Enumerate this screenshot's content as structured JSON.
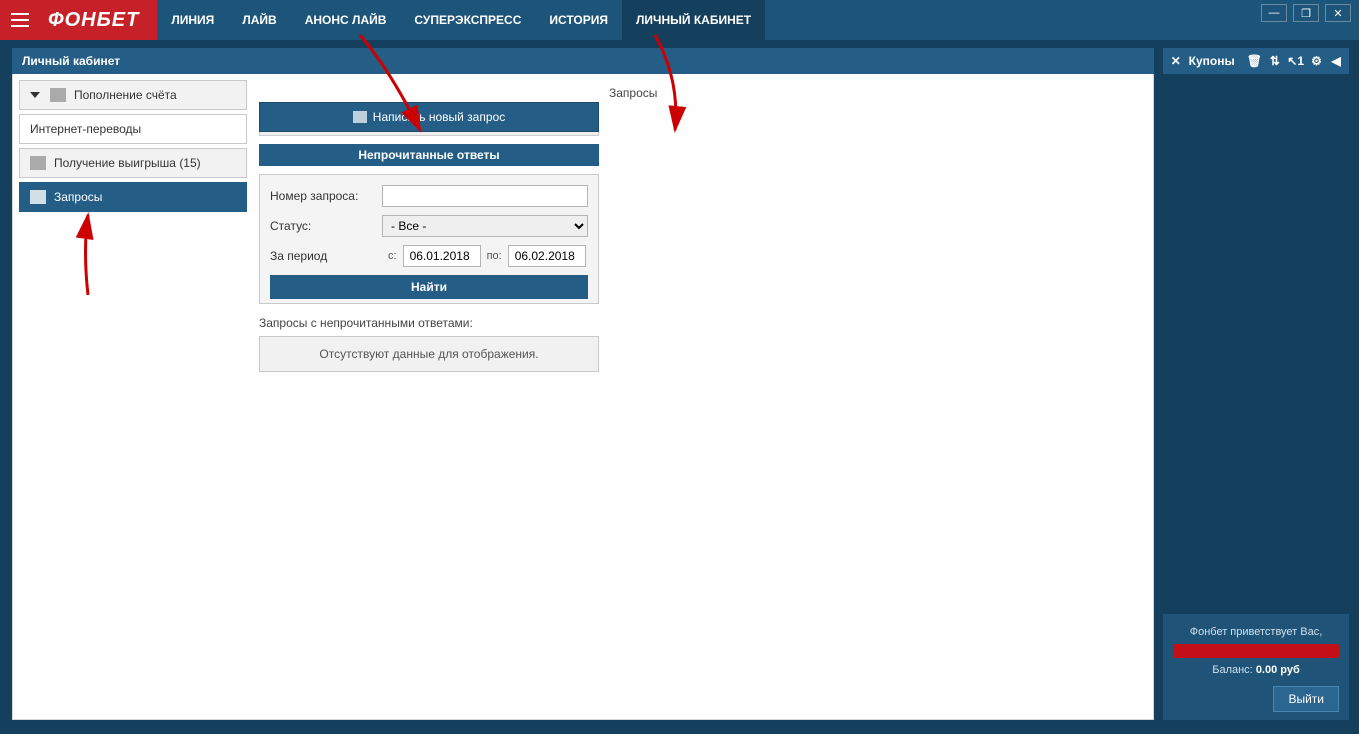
{
  "brand": "ФОНБЕТ",
  "nav": [
    "ЛИНИЯ",
    "ЛАЙВ",
    "АНОНС ЛАЙВ",
    "СУПЕРЭКСПРЕСС",
    "ИСТОРИЯ",
    "ЛИЧНЫЙ КАБИНЕТ"
  ],
  "nav_active_index": 5,
  "section_title": "Личный кабинет",
  "sidebar": {
    "items": [
      {
        "label": "Пополнение счёта",
        "kind": "group"
      },
      {
        "label": "Интернет-переводы",
        "kind": "sub"
      },
      {
        "label": "Получение выигрыша (15)",
        "kind": "item"
      },
      {
        "label": "Запросы",
        "kind": "active"
      }
    ]
  },
  "main": {
    "page_title": "Запросы",
    "new_request_btn": "Написать новый запрос",
    "unread_header": "Непрочитанные ответы",
    "form": {
      "num_label": "Номер запроса:",
      "num_value": "",
      "status_label": "Статус:",
      "status_value": "- Все -",
      "period_label": "За период",
      "from_lbl": "с:",
      "from_value": "06.01.2018",
      "to_lbl": "по:",
      "to_value": "06.02.2018",
      "find_btn": "Найти"
    },
    "unread_caption": "Запросы с непрочитанными ответами:",
    "empty_text": "Отсутствуют данные для отображения."
  },
  "right": {
    "coupons_label": "Купоны",
    "badge": "1",
    "greeting": "Фонбет приветствует Вас,",
    "balance_label": "Баланс:",
    "balance_value": "0.00 руб",
    "logout": "Выйти"
  },
  "window_controls": {
    "min": "—",
    "max": "❐",
    "close": "✕"
  }
}
